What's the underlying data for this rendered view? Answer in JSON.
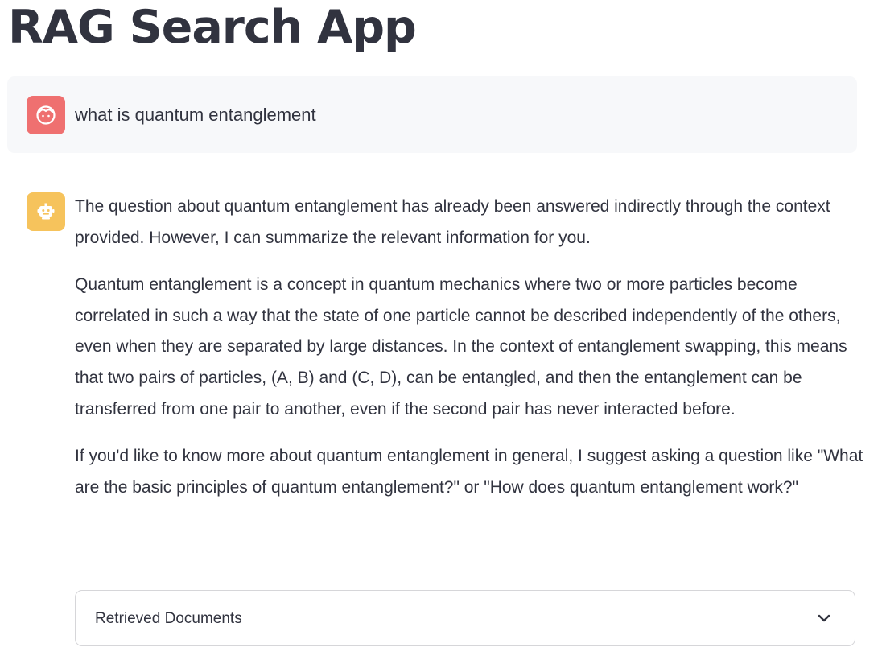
{
  "app": {
    "title": "RAG Search App"
  },
  "chat": {
    "user_message": {
      "avatar_icon": "face-icon",
      "avatar_color": "#ef7070",
      "text": "what is quantum entanglement"
    },
    "assistant_message": {
      "avatar_icon": "robot-icon",
      "avatar_color": "#f6c35c",
      "paragraphs": [
        "The question about quantum entanglement has already been answered indirectly through the context provided. However, I can summarize the relevant information for you.",
        "Quantum entanglement is a concept in quantum mechanics where two or more particles become correlated in such a way that the state of one particle cannot be described independently of the others, even when they are separated by large distances. In the context of entanglement swapping, this means that two pairs of particles, (A, B) and (C, D), can be entangled, and then the entanglement can be transferred from one pair to another, even if the second pair has never interacted before.",
        "If you'd like to know more about quantum entanglement in general, I suggest asking a question like \"What are the basic principles of quantum entanglement?\" or \"How does quantum entanglement work?\""
      ]
    },
    "expander": {
      "label": "Retrieved Documents",
      "icon": "chevron-down-icon"
    }
  },
  "colors": {
    "text": "#31333f",
    "user_bubble_bg": "#f7f8fa",
    "border": "#d6d6d9"
  }
}
